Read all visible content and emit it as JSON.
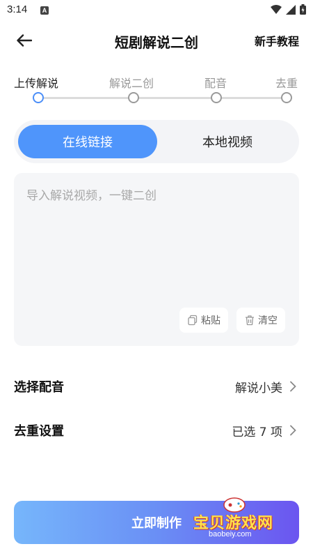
{
  "status_bar": {
    "time": "3:14",
    "notification_badge": "A"
  },
  "header": {
    "title": "短剧解说二创",
    "tutorial": "新手教程"
  },
  "steps": [
    {
      "label": "上传解说",
      "active": true
    },
    {
      "label": "解说二创",
      "active": false
    },
    {
      "label": "配音",
      "active": false
    },
    {
      "label": "去重",
      "active": false
    }
  ],
  "tabs": {
    "online": "在线链接",
    "local": "本地视频",
    "selected": "online"
  },
  "input": {
    "placeholder": "导入解说视频，一键二创",
    "value": ""
  },
  "actions": {
    "paste": "粘贴",
    "clear": "清空"
  },
  "settings": {
    "voice": {
      "label": "选择配音",
      "value": "解说小美"
    },
    "dedup": {
      "label": "去重设置",
      "value": "已选 7 项"
    }
  },
  "make_button": "立即制作",
  "watermark": {
    "text": "宝贝游戏网",
    "url": "baobeiy.com"
  },
  "colors": {
    "accent": "#4f95fb",
    "step_active": "#4b8ef8",
    "button_start": "#76b6fb",
    "button_end": "#6b55f0"
  }
}
